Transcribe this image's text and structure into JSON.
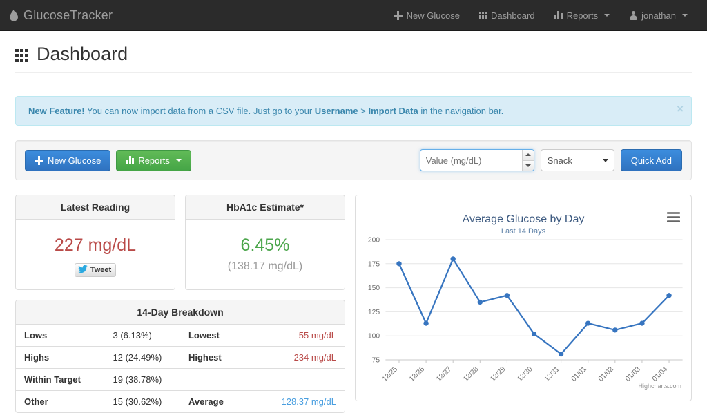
{
  "navbar": {
    "brand": "GlucoseTracker",
    "brand_icon": "droplet-icon",
    "items": [
      {
        "label": "New Glucose",
        "icon": "plus-icon",
        "caret": false
      },
      {
        "label": "Dashboard",
        "icon": "grid-icon",
        "caret": false
      },
      {
        "label": "Reports",
        "icon": "bar-chart-icon",
        "caret": true
      },
      {
        "label": "jonathan",
        "icon": "user-icon",
        "caret": true
      }
    ]
  },
  "page": {
    "title": "Dashboard",
    "icon": "grid-icon"
  },
  "alert": {
    "strong": "New Feature!",
    "text_1": " You can now import data from a CSV file. Just go to your ",
    "link_1": "Username",
    "separator": " > ",
    "link_2": "Import Data",
    "text_2": " in the navigation bar.",
    "close_label": "×"
  },
  "toolbar": {
    "new_glucose_label": "New Glucose",
    "reports_label": "Reports",
    "value_placeholder": "Value (mg/dL)",
    "value": "",
    "category_selected": "Snack",
    "category_options": [
      "Snack"
    ],
    "quick_add_label": "Quick Add"
  },
  "latest_reading": {
    "title": "Latest Reading",
    "value": "227 mg/dL",
    "tweet_label": "Tweet",
    "color": "#b94a48"
  },
  "hba1c": {
    "title": "HbA1c Estimate*",
    "value": "6.45%",
    "sub": "(138.17 mg/dL)",
    "color": "#4ca64c"
  },
  "breakdown": {
    "title": "14-Day Breakdown",
    "rows": [
      {
        "label": "Lows",
        "value": "3 (6.13%)",
        "label2": "Lowest",
        "value2": "55 mg/dL",
        "value2_class": "txt-red"
      },
      {
        "label": "Highs",
        "value": "12 (24.49%)",
        "label2": "Highest",
        "value2": "234 mg/dL",
        "value2_class": "txt-red"
      },
      {
        "label": "Within Target",
        "value": "19 (38.78%)",
        "label2": "",
        "value2": "",
        "value2_class": ""
      },
      {
        "label": "Other",
        "value": "15 (30.62%)",
        "label2": "Average",
        "value2": "128.37 mg/dL",
        "value2_class": "txt-blue"
      }
    ]
  },
  "chart_data": {
    "type": "line",
    "title": "Average Glucose by Day",
    "subtitle": "Last 14 Days",
    "xlabel": "",
    "ylabel": "",
    "ylim": [
      75,
      200
    ],
    "yticks": [
      75,
      100,
      125,
      150,
      175,
      200
    ],
    "grid": true,
    "legend": false,
    "credit": "Highcharts.com",
    "menu_icon": "hamburger-icon",
    "series_color": "#3775c0",
    "categories": [
      "12/25",
      "12/26",
      "12/27",
      "12/28",
      "12/29",
      "12/30",
      "12/31",
      "01/01",
      "01/02",
      "01/03",
      "01/04"
    ],
    "values": [
      175,
      113,
      180,
      135,
      142,
      102,
      81,
      113,
      106,
      113,
      142
    ]
  }
}
